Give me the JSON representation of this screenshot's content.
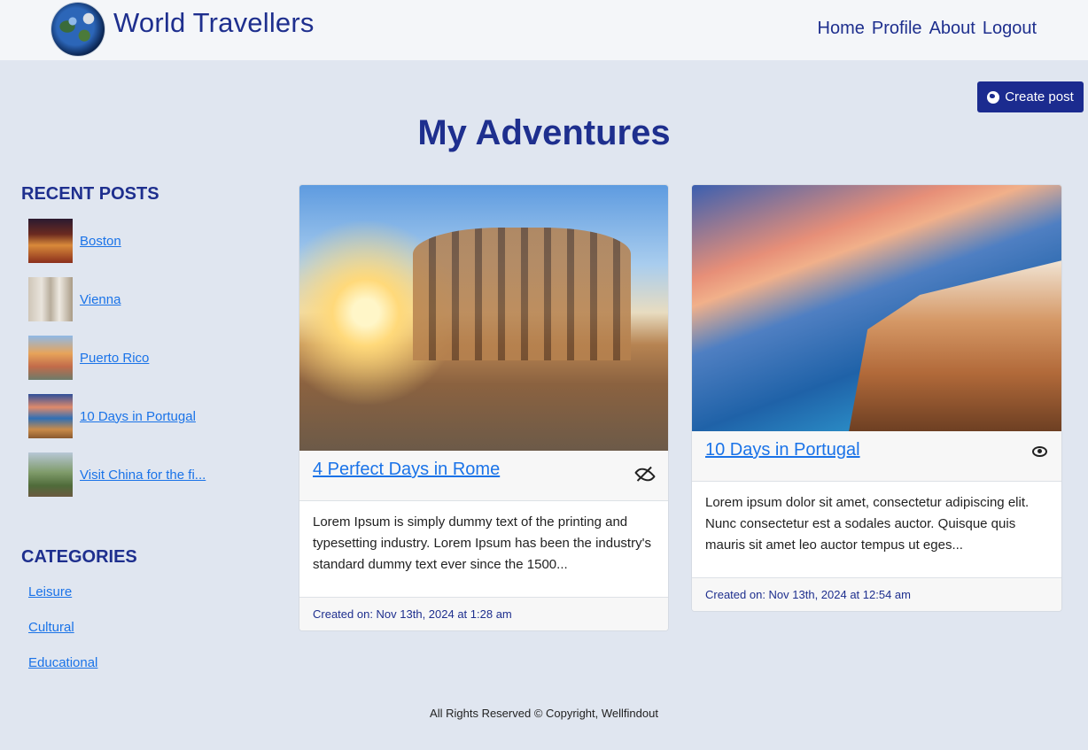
{
  "header": {
    "brand": "World Travellers",
    "nav": [
      "Home",
      "Profile",
      "About",
      "Logout"
    ]
  },
  "actions": {
    "create_post": "Create post"
  },
  "page_title": "My Adventures",
  "sidebar": {
    "recent_heading": "RECENT POSTS",
    "recent_posts": [
      "Boston",
      "Vienna",
      "Puerto Rico",
      "10 Days in Portugal",
      "Visit China for the fi..."
    ],
    "categories_heading": "CATEGORIES",
    "categories": [
      "Leisure",
      "Cultural",
      "Educational"
    ]
  },
  "posts": [
    {
      "title": "4 Perfect Days in Rome",
      "visibility_icon": "eye-slash-icon",
      "excerpt": "Lorem Ipsum is simply dummy text of the printing and typesetting industry. Lorem Ipsum has been the industry's standard dummy text ever since the 1500...",
      "created": "Created on: Nov 13th, 2024 at 1:28 am"
    },
    {
      "title": "10 Days in Portugal",
      "visibility_icon": "eye-icon",
      "excerpt": "Lorem ipsum dolor sit amet, consectetur adipiscing elit. Nunc consectetur est a sodales auctor. Quisque quis mauris sit amet leo auctor tempus ut eges...",
      "created": "Created on: Nov 13th, 2024 at 12:54 am"
    }
  ],
  "footer": "All Rights Reserved © Copyright, Wellfindout",
  "colors": {
    "brand": "#1e2f8e",
    "button": "#1b2b8f",
    "background": "#e0e6f0",
    "link": "#1a73e8"
  }
}
